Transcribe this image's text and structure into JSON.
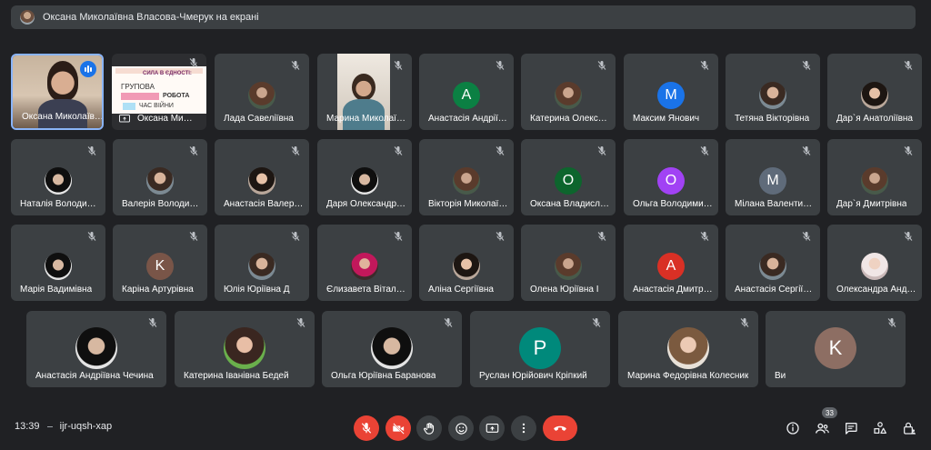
{
  "banner": {
    "text": "Оксана Миколаївна Власова-Чмерук на екрані"
  },
  "tiles": [
    {
      "name": "Оксана Миколаївна Власова-Чмерук"
    },
    {
      "name": "Оксана Миколаївна Власова-Чмерук"
    },
    {
      "name": "Лада Савеліївна"
    },
    {
      "name": "Марина Миколаївна"
    },
    {
      "name": "Анастасія Андріївна",
      "initial": "A",
      "color": "#0b8043"
    },
    {
      "name": "Катерина Олександрівна"
    },
    {
      "name": "Максим Янович",
      "initial": "M",
      "color": "#1a73e8"
    },
    {
      "name": "Тетяна Вікторівна"
    },
    {
      "name": "Дар`я Анатоліївна"
    },
    {
      "name": "Наталія Володимирівна"
    },
    {
      "name": "Валерія Володимирівна"
    },
    {
      "name": "Анастасія Валеріївна"
    },
    {
      "name": "Даря Олександрівна"
    },
    {
      "name": "Вікторія Миколаївна"
    },
    {
      "name": "Оксана Владиславівна",
      "initial": "O",
      "color": "#0d652d"
    },
    {
      "name": "Ольга Володимирівна",
      "initial": "O",
      "color": "#a142f4"
    },
    {
      "name": "Мілана Валентинівна",
      "initial": "M",
      "color": "#5f6b7a"
    },
    {
      "name": "Дар`я Дмитрівна"
    },
    {
      "name": "Марія Вадимівна"
    },
    {
      "name": "Каріна Артурівна",
      "initial": "K",
      "color": "#795548"
    },
    {
      "name": "Юлія Юріївна Д"
    },
    {
      "name": "Єлизавета Віталіївна"
    },
    {
      "name": "Аліна Сергіївна"
    },
    {
      "name": "Олена Юріївна І"
    },
    {
      "name": "Анастасія Дмитрівна",
      "initial": "A",
      "color": "#d93025"
    },
    {
      "name": "Анастасія Сергіївна"
    },
    {
      "name": "Олександра Андріївна"
    },
    {
      "name": "Анастасія Андріївна Чечина"
    },
    {
      "name": "Катерина Іванівна Бедей"
    },
    {
      "name": "Ольга Юріївна Баранова"
    },
    {
      "name": "Руслан Юрійович Кріпкий",
      "initial": "P",
      "color": "#00897b"
    },
    {
      "name": "Марина Федорівна Колесник"
    },
    {
      "name": "Ви",
      "initial": "K",
      "color": "#8d6e63"
    }
  ],
  "slide": {
    "line1": "СИЛА В ЄДНОСТІ:",
    "line2": "ГРУПОВА",
    "line3": "РОБОТА",
    "line4": "ЧАС ВІЙНИ"
  },
  "footer": {
    "time": "13:39",
    "meeting_code": "ijr-uqsh-xap",
    "participants_count": "33"
  }
}
